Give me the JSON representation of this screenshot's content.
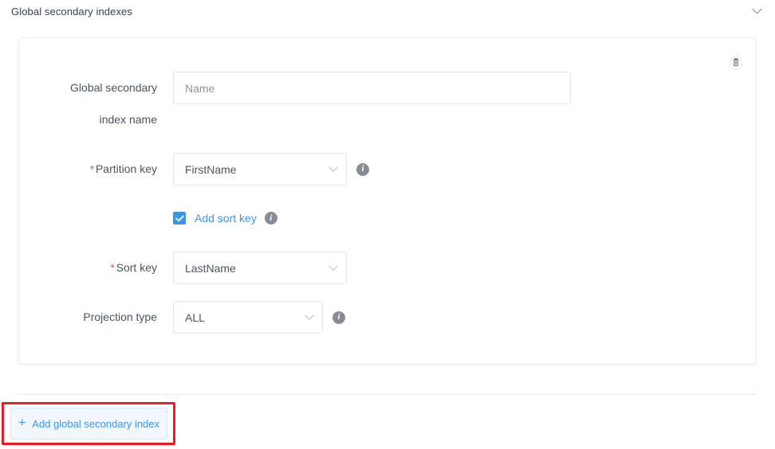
{
  "section": {
    "title": "Global secondary indexes",
    "collapse_icon": "chevron-down-icon"
  },
  "index_card": {
    "delete_icon": "trash-icon",
    "fields": {
      "index_name": {
        "label": "Global secondary index name",
        "label_line1": "Global secondary",
        "label_line2": "index name",
        "placeholder": "Name",
        "value": ""
      },
      "partition_key": {
        "required_marker": "*",
        "label": "Partition key",
        "value": "FirstName",
        "info_icon": "info-icon",
        "info_glyph": "i"
      },
      "add_sort_key": {
        "label": "Add sort key",
        "checked": true,
        "info_icon": "info-icon",
        "info_glyph": "i"
      },
      "sort_key": {
        "required_marker": "*",
        "label": "Sort key",
        "value": "LastName"
      },
      "projection_type": {
        "label": "Projection type",
        "value": "ALL",
        "info_icon": "info-icon",
        "info_glyph": "i"
      }
    }
  },
  "footer": {
    "add_button": {
      "plus": "+",
      "label": "Add global secondary index"
    },
    "highlight_color": "#ed1c24"
  },
  "colors": {
    "accent_blue": "#3c96e8",
    "required_red": "#e8423f",
    "border_gray": "#e3e5ea",
    "text_dark": "#37414c",
    "label_gray": "#4b545d",
    "button_fill": "#f2f7fd",
    "highlight_red": "#ed1c24"
  }
}
